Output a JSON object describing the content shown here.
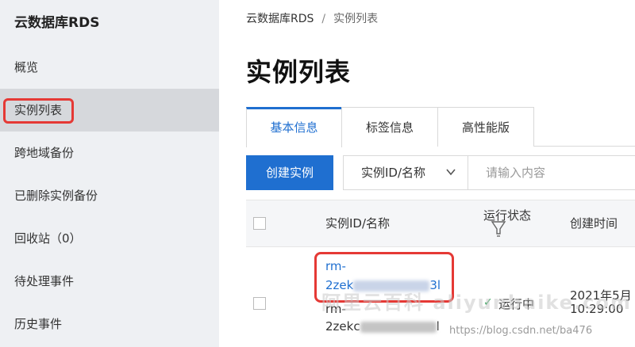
{
  "sidebar": {
    "title": "云数据库RDS",
    "items": [
      {
        "label": "概览"
      },
      {
        "label": "实例列表"
      },
      {
        "label": "跨地域备份"
      },
      {
        "label": "已删除实例备份"
      },
      {
        "label": "回收站（0）"
      },
      {
        "label": "待处理事件"
      },
      {
        "label": "历史事件"
      }
    ],
    "active_index": 1
  },
  "breadcrumb": {
    "root": "云数据库RDS",
    "separator": "/",
    "current": "实例列表"
  },
  "page_title": "实例列表",
  "tabs": [
    {
      "label": "基本信息",
      "active": true
    },
    {
      "label": "标签信息",
      "active": false
    },
    {
      "label": "高性能版",
      "active": false
    }
  ],
  "toolbar": {
    "create_label": "创建实例",
    "filter_select": "实例ID/名称",
    "search_placeholder": "请输入内容"
  },
  "table": {
    "headers": {
      "id_name": "实例ID/名称",
      "status": "运行状态",
      "created": "创建时间"
    },
    "rows": [
      {
        "id_line1": "rm-",
        "id_line2": "2zek",
        "id_suffix": "3l",
        "name_line1": "rm-",
        "name_line2": "2zekc",
        "name_suffix": "l",
        "status": "运行中",
        "created_date": "2021年5月",
        "created_time": "10:29:00"
      }
    ]
  },
  "watermark": {
    "text": "阿里云百科 aliyunbaike.com",
    "url": "https://blog.csdn.net/ba476"
  },
  "colors": {
    "accent": "#1f6fd0",
    "highlight": "#e53935",
    "ok": "#35a35a",
    "sidebar_bg": "#eef0f3"
  }
}
